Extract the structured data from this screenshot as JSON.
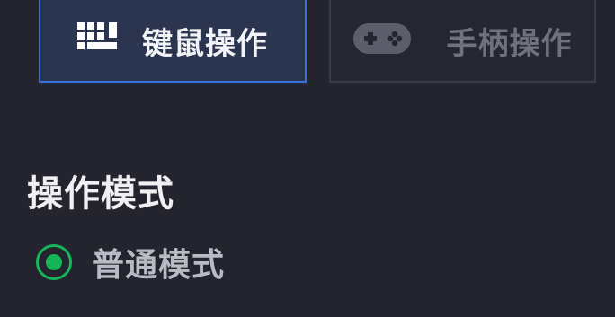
{
  "tabs": {
    "keyboard": {
      "label": "键鼠操作",
      "icon": "keyboard-mouse-icon",
      "active": true
    },
    "gamepad": {
      "label": "手柄操作",
      "icon": "gamepad-icon",
      "active": false
    }
  },
  "operation_mode": {
    "title": "操作模式",
    "options": [
      {
        "label": "普通模式",
        "selected": true
      }
    ]
  },
  "colors": {
    "background": "#24242f",
    "active_tab_border": "#3a72d9",
    "active_tab_bg": "#2b3550",
    "inactive_tab_border": "#3a3b47",
    "radio_accent": "#17b55a"
  }
}
